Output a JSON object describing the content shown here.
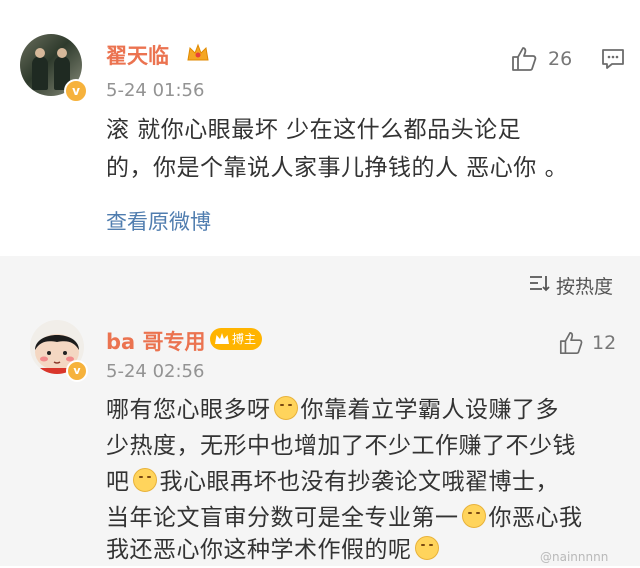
{
  "comment1": {
    "username": "翟天临",
    "time": "5-24 01:56",
    "likes": "26",
    "text_line1": "滚  就你心眼最坏  少在这什么都品头论足",
    "text_line2": "的，你是个靠说人家事儿挣钱的人  恶心你  。",
    "view_original": "查看原微博"
  },
  "sort": {
    "label": "按热度"
  },
  "comment2": {
    "username": "ba 哥专用",
    "badge": "搏主",
    "time": "5-24 02:56",
    "likes": "12",
    "line1a": "哪有您心眼多呀",
    "line1b": "你靠着立学霸人设赚了多",
    "line2": "少热度，无形中也增加了不少工作赚了不少钱",
    "line3a": "吧",
    "line3b": "我心眼再坏也没有抄袭论文哦翟博士，",
    "line4a": "当年论文盲审分数可是全专业第一",
    "line4b": "你恶心我",
    "line5a": "我还恶心你这种学术作假的呢"
  },
  "watermark": "@nainnnnn"
}
